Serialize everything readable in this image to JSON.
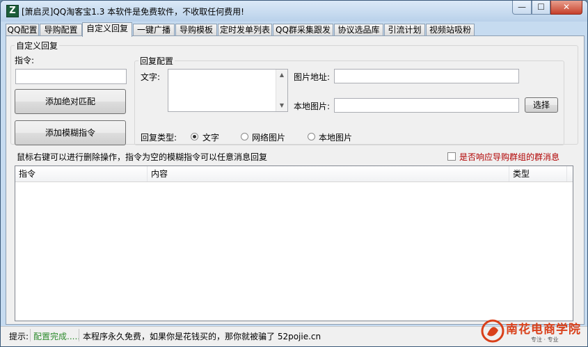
{
  "window": {
    "title": "[箫启灵]QQ淘客宝1.3  本软件是免费软件，不收取任何费用!",
    "minimize_glyph": "—",
    "maximize_glyph": "☐",
    "close_glyph": "✕",
    "app_icon_letter": "Z"
  },
  "tabs": [
    {
      "label": "QQ配置"
    },
    {
      "label": "导购配置"
    },
    {
      "label": "自定义回复"
    },
    {
      "label": "一键广播"
    },
    {
      "label": "导购模板"
    },
    {
      "label": "定时发单列表"
    },
    {
      "label": "QQ群采集跟发"
    },
    {
      "label": "协议选品库"
    },
    {
      "label": "引流计划"
    },
    {
      "label": "视频站吸粉"
    }
  ],
  "custom_reply": {
    "group_title": "自定义回复",
    "command_label": "指令:",
    "command_value": "",
    "add_exact_button": "添加绝对匹配",
    "add_fuzzy_button": "添加模糊指令",
    "reply_config": {
      "group_title": "回复配置",
      "text_label": "文字:",
      "text_value": "",
      "image_url_label": "图片地址:",
      "image_url_value": "",
      "local_image_label": "本地图片:",
      "local_image_value": "",
      "select_button": "选择",
      "reply_type_label": "回复类型:",
      "reply_types": [
        "文字",
        "网络图片",
        "本地图片"
      ],
      "selected_reply_type": "文字"
    },
    "hint": "鼠标右键可以进行删除操作，指令为空的模糊指令可以任意消息回复",
    "respond_group_checkbox": "是否响应导购群组的群消息",
    "respond_group_checked": false,
    "table": {
      "columns": [
        "指令",
        "内容",
        "类型"
      ],
      "rows": []
    }
  },
  "statusbar": {
    "prefix": "提示:",
    "status": "配置完成.....",
    "message": "本程序永久免费，如果你是花钱买的，那你就被骗了   52pojie.cn"
  },
  "watermark": {
    "text": "南花电商学院",
    "subtext": "专注 · 专业"
  },
  "colors": {
    "status_green": "#2e8b2e",
    "checkbox_label_red": "#b00000",
    "logo_red": "#d9401a"
  }
}
